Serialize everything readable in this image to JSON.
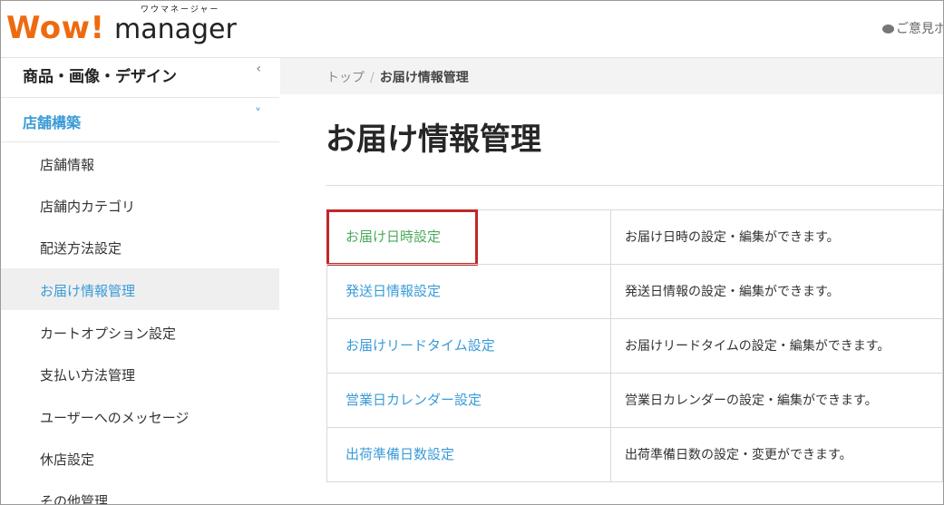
{
  "header": {
    "logo_wow": "Wow!",
    "logo_manager": "manager",
    "logo_kana": "ワウマネージャー",
    "feedback": "ご意見ボ"
  },
  "sidebar": {
    "sections": [
      {
        "label": "商品・画像・デザイン",
        "chevron": "‹",
        "color": "#222222"
      },
      {
        "label": "店舗構築",
        "chevron": "˅",
        "color": "#3a9bd8"
      }
    ],
    "items": [
      {
        "label": "店舗情報"
      },
      {
        "label": "店舗内カテゴリ"
      },
      {
        "label": "配送方法設定"
      },
      {
        "label": "お届け情報管理",
        "active": true
      },
      {
        "label": "カートオプション設定"
      },
      {
        "label": "支払い方法管理"
      },
      {
        "label": "ユーザーへのメッセージ"
      },
      {
        "label": "休店設定"
      },
      {
        "label": "その他管理"
      }
    ]
  },
  "breadcrumb": {
    "home": "トップ",
    "separator": "/",
    "current": "お届け情報管理"
  },
  "page_title": "お届け情報管理",
  "table": {
    "rows": [
      {
        "link": "お届け日時設定",
        "desc": "お届け日時の設定・編集ができます。",
        "link_color": "#4aab5a",
        "highlighted": true
      },
      {
        "link": "発送日情報設定",
        "desc": "発送日情報の設定・編集ができます。",
        "link_color": "#3a9bd8"
      },
      {
        "link": "お届けリードタイム設定",
        "desc": "お届けリードタイムの設定・編集ができます。",
        "link_color": "#3a9bd8"
      },
      {
        "link": "営業日カレンダー設定",
        "desc": "営業日カレンダーの設定・編集ができます。",
        "link_color": "#3a9bd8"
      },
      {
        "link": "出荷準備日数設定",
        "desc": "出荷準備日数の設定・変更ができます。",
        "link_color": "#3a9bd8"
      }
    ]
  },
  "colors": {
    "brand_orange": "#ee6a10",
    "link_blue": "#3a9bd8",
    "highlight_red": "#c0282b"
  }
}
